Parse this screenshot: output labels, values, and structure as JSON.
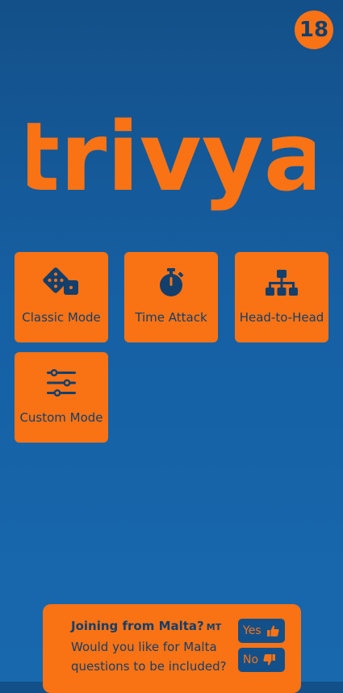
{
  "header": {
    "age_rating": "18"
  },
  "logo": {
    "text": "trivya"
  },
  "modes": [
    {
      "label": "Classic Mode",
      "icon": "dice-icon"
    },
    {
      "label": "Time Attack",
      "icon": "stopwatch-icon"
    },
    {
      "label": "Head-to-Head",
      "icon": "hierarchy-icon"
    },
    {
      "label": "Custom Mode",
      "icon": "sliders-icon"
    }
  ],
  "banner": {
    "title": "Joining from Malta?",
    "country_code": "MT",
    "question": "Would you like for Malta questions to be included?",
    "yes_label": "Yes",
    "no_label": "No"
  },
  "colors": {
    "background": "#1660a4",
    "accent": "#f97315",
    "dark_text": "#123f6c"
  }
}
